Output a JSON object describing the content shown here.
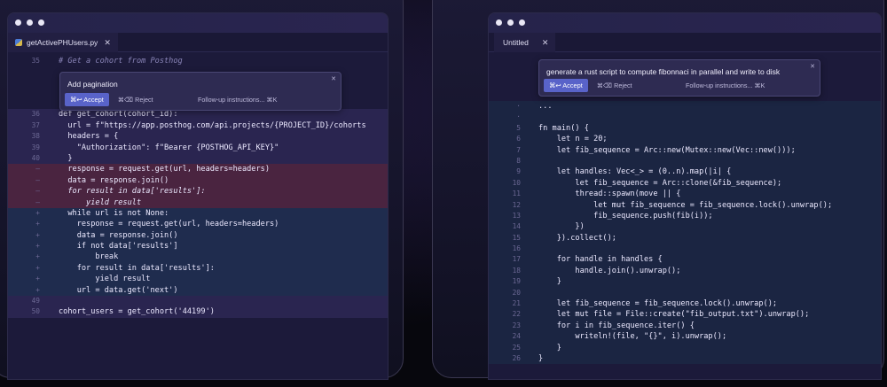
{
  "left": {
    "tab": {
      "filename": "getActivePHUsers.py",
      "close": "✕"
    },
    "prompt": {
      "title": "Add pagination",
      "accept": "⌘↩ Accept",
      "reject": "⌘⌫ Reject",
      "followup": "Follow-up instructions... ⌘K",
      "close": "✕"
    },
    "lines": [
      {
        "n": "35",
        "t": "# Get a cohort from Posthog",
        "k": "comment"
      },
      {
        "n": "36",
        "t": "def get_cohort(cohort_id):",
        "k": "mod"
      },
      {
        "n": "37",
        "t": "  url = f\"https://app.posthog.com/api.projects/{PROJECT_ID}/cohorts",
        "k": "mod"
      },
      {
        "n": "38",
        "t": "  headers = {",
        "k": "mod"
      },
      {
        "n": "39",
        "t": "    \"Authorization\": f\"Bearer {POSTHOG_API_KEY}\"",
        "k": "mod"
      },
      {
        "n": "40",
        "t": "  }",
        "k": "mod"
      },
      {
        "n": "–",
        "t": "  response = request.get(url, headers=headers)",
        "k": "del"
      },
      {
        "n": "–",
        "t": "  data = response.join()",
        "k": "del"
      },
      {
        "n": "–",
        "t": "  for result in data['results']:",
        "k": "del-i"
      },
      {
        "n": "–",
        "t": "      yield result",
        "k": "del-i"
      },
      {
        "n": "+",
        "t": "  while url is not None:",
        "k": "add"
      },
      {
        "n": "+",
        "t": "    response = request.get(url, headers=headers)",
        "k": "add"
      },
      {
        "n": "+",
        "t": "    data = response.join()",
        "k": "add"
      },
      {
        "n": "+",
        "t": "    if not data['results']",
        "k": "add"
      },
      {
        "n": "+",
        "t": "        break",
        "k": "add"
      },
      {
        "n": "+",
        "t": "    for result in data['results']:",
        "k": "add"
      },
      {
        "n": "+",
        "t": "        yield result",
        "k": "add"
      },
      {
        "n": "+",
        "t": "    url = data.get('next')",
        "k": "add"
      },
      {
        "n": "49",
        "t": "",
        "k": "mod"
      },
      {
        "n": "50",
        "t": "cohort_users = get_cohort('44199')",
        "k": "mod"
      }
    ]
  },
  "right": {
    "tab": {
      "filename": "Untitled",
      "close": "✕"
    },
    "prompt": {
      "title": "generate a rust script to compute fibonnaci in parallel and write to disk",
      "accept": "⌘↩ Accept",
      "reject": "⌘⌫ Reject",
      "followup": "Follow-up instructions... ⌘K",
      "close": "✕"
    },
    "lines": [
      {
        "n": "·",
        "t": "..."
      },
      {
        "n": "·",
        "t": ""
      },
      {
        "n": "5",
        "t": "fn main() {"
      },
      {
        "n": "6",
        "t": "    let n = 20;"
      },
      {
        "n": "7",
        "t": "    let fib_sequence = Arc::new(Mutex::new(Vec::new()));"
      },
      {
        "n": "8",
        "t": ""
      },
      {
        "n": "9",
        "t": "    let handles: Vec<_> = (0..n).map(|i| {"
      },
      {
        "n": "10",
        "t": "        let fib_sequence = Arc::clone(&fib_sequence);"
      },
      {
        "n": "11",
        "t": "        thread::spawn(move || {"
      },
      {
        "n": "12",
        "t": "            let mut fib_sequence = fib_sequence.lock().unwrap();"
      },
      {
        "n": "13",
        "t": "            fib_sequence.push(fib(i));"
      },
      {
        "n": "14",
        "t": "        })"
      },
      {
        "n": "15",
        "t": "    }).collect();"
      },
      {
        "n": "16",
        "t": ""
      },
      {
        "n": "17",
        "t": "    for handle in handles {"
      },
      {
        "n": "18",
        "t": "        handle.join().unwrap();"
      },
      {
        "n": "19",
        "t": "    }"
      },
      {
        "n": "20",
        "t": ""
      },
      {
        "n": "21",
        "t": "    let fib_sequence = fib_sequence.lock().unwrap();"
      },
      {
        "n": "22",
        "t": "    let mut file = File::create(\"fib_output.txt\").unwrap();"
      },
      {
        "n": "23",
        "t": "    for i in fib_sequence.iter() {"
      },
      {
        "n": "24",
        "t": "        writeln!(file, \"{}\", i).unwrap();"
      },
      {
        "n": "25",
        "t": "    }"
      },
      {
        "n": "26",
        "t": "}"
      }
    ]
  }
}
